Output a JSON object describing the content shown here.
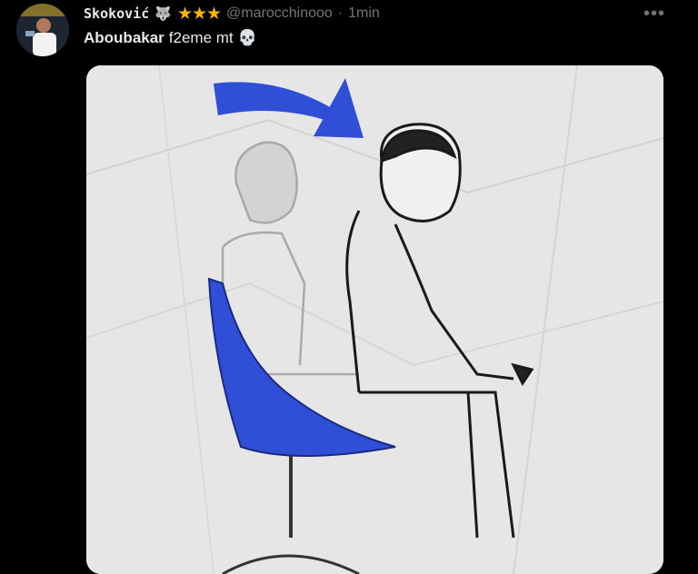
{
  "tweet": {
    "display_name": "Skoković",
    "badge_icon": "wolf-emoji-icon",
    "stars": "★★★",
    "handle": "@marocchinooo",
    "separator": "·",
    "time": "1min",
    "more_icon": "more-horizontal-icon",
    "text_mention": "Aboubakar",
    "text_body": "f2eme mt",
    "text_emoji": "💀"
  },
  "media": {
    "description_icon": "meme-drawing-image"
  },
  "colors": {
    "background": "#000000",
    "text": "#e7e9ea",
    "secondary": "#71767b",
    "stars": "#f4b400",
    "accent_blue": "#2f4fd6"
  }
}
